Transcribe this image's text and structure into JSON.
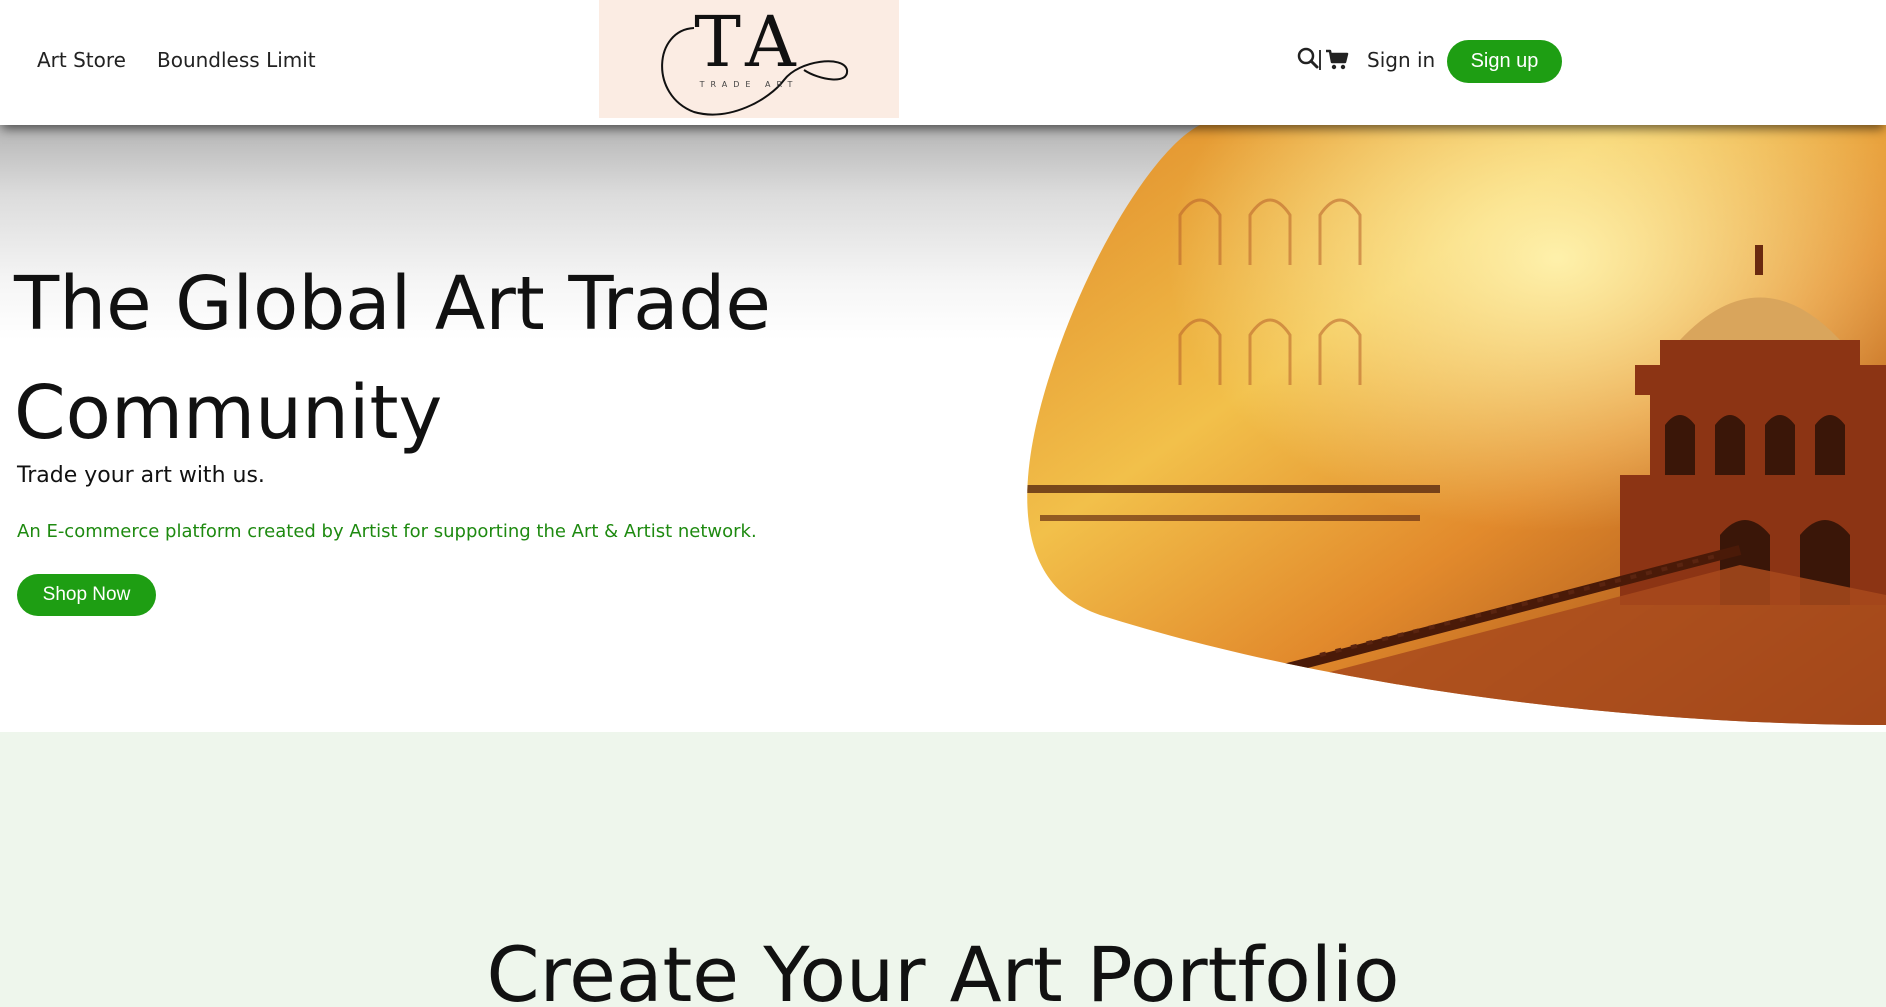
{
  "nav": {
    "links": [
      "Art Store",
      "Boundless Limit"
    ],
    "sign_in": "Sign in",
    "sign_up": "Sign up"
  },
  "logo": {
    "letters": "TA",
    "subtitle": "TRADE ART"
  },
  "hero": {
    "title": "The Global Art Trade Community",
    "subtitle": "Trade your art with us.",
    "description": "An E-commerce platform created by Artist for supporting the Art & Artist network.",
    "cta": "Shop Now"
  },
  "section2": {
    "title": "Create Your Art Portfolio"
  },
  "colors": {
    "accent_green": "#1e9e13",
    "text_green": "#1e8a10",
    "logo_bg": "#fbece3",
    "section_bg": "#eef6ec"
  },
  "icons": [
    "search-icon",
    "cart-icon"
  ]
}
